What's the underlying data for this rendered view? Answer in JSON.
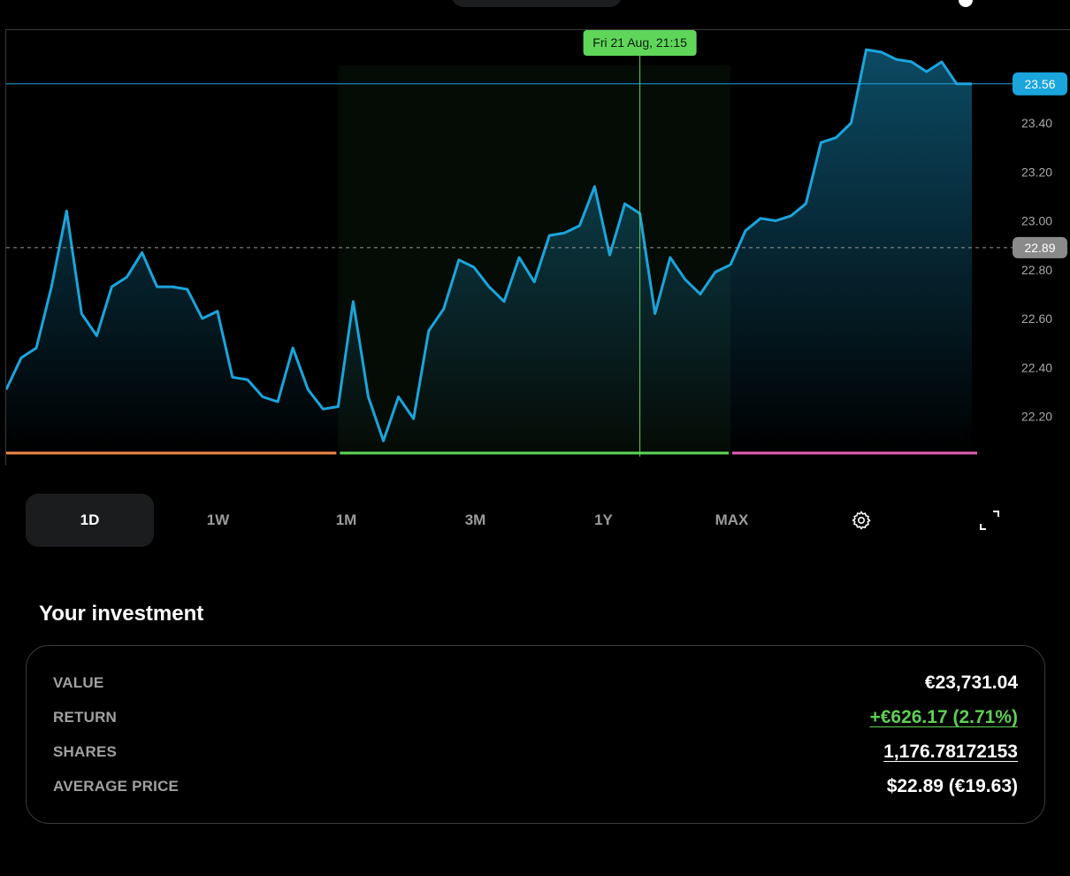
{
  "colors": {
    "line": "#1aa5dc",
    "crosshair": "#5fd65a",
    "tooltip_bg": "#5fd65a",
    "price_badge": "#1aa5dc",
    "ref_badge": "#8a8a8a",
    "segment_1": "#f0894a",
    "segment_2": "#5fd65a",
    "segment_3": "#e45fb4",
    "positive": "#5fcf54"
  },
  "chart": {
    "tooltip": "Fri 21 Aug, 21:15",
    "current_price_label": "23.56",
    "reference_price_label": "22.89",
    "y_tick_labels": [
      "23.40",
      "23.20",
      "23.00",
      "22.80",
      "22.60",
      "22.40",
      "22.20"
    ]
  },
  "chart_data": {
    "type": "area",
    "series": [
      {
        "values": [
          22.31,
          22.44,
          22.48,
          22.73,
          23.04,
          22.62,
          22.53,
          22.73,
          22.77,
          22.87,
          22.73,
          22.73,
          22.72,
          22.6,
          22.63,
          22.36,
          22.35,
          22.28,
          22.26,
          22.48,
          22.31,
          22.23,
          22.24,
          22.67,
          22.28,
          22.1,
          22.28,
          22.19,
          22.55,
          22.64,
          22.84,
          22.81,
          22.73,
          22.67,
          22.85,
          22.75,
          22.94,
          22.95,
          22.98,
          23.14,
          22.86,
          23.07,
          23.03,
          22.62,
          22.85,
          22.76,
          22.7,
          22.79,
          22.82,
          22.96,
          23.01,
          23.0,
          23.02,
          23.07,
          23.32,
          23.34,
          23.4,
          23.7,
          23.69,
          23.66,
          23.65,
          23.61,
          23.65,
          23.56,
          23.56
        ]
      }
    ],
    "ylim": [
      22.05,
      23.78
    ],
    "y_ticks": [
      22.2,
      22.4,
      22.6,
      22.8,
      23.0,
      23.2,
      23.4
    ],
    "current_price": 23.56,
    "reference_price": 22.89,
    "crosshair_index": 42,
    "highlight_range": [
      22,
      48
    ],
    "segments": [
      [
        0,
        22
      ],
      [
        22,
        48
      ],
      [
        48,
        64
      ]
    ],
    "grid": false
  },
  "range_tabs": [
    {
      "label": "1D",
      "active": true
    },
    {
      "label": "1W",
      "active": false
    },
    {
      "label": "1M",
      "active": false
    },
    {
      "label": "3M",
      "active": false
    },
    {
      "label": "1Y",
      "active": false
    },
    {
      "label": "MAX",
      "active": false
    }
  ],
  "icons": {
    "settings": "gear-icon",
    "fullscreen": "expand-icon"
  },
  "investment": {
    "title": "Your investment",
    "rows": [
      {
        "label": "VALUE",
        "value": "€23,731.04",
        "style": "plain"
      },
      {
        "label": "RETURN",
        "value": "+€626.17 (2.71%)",
        "style": "green-link"
      },
      {
        "label": "SHARES",
        "value": "1,176.78172153",
        "style": "link"
      },
      {
        "label": "AVERAGE PRICE",
        "value": "$22.89 (€19.63)",
        "style": "plain"
      }
    ]
  }
}
